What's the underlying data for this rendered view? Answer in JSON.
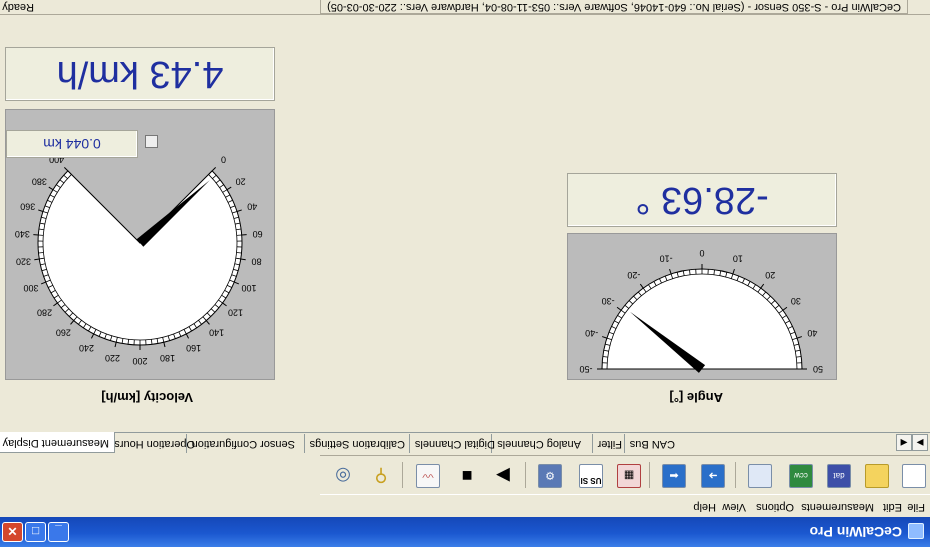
{
  "window": {
    "title": "CeCalWin Pro"
  },
  "menu": [
    "File",
    "Edit",
    "Measurements",
    "Options",
    "View",
    "Help"
  ],
  "toolbar": [
    {
      "icon": "new-file-icon"
    },
    {
      "icon": "open-folder-icon"
    },
    {
      "icon": "save-disk-icon",
      "label": "dat"
    },
    {
      "icon": "export-ccw-icon",
      "label": "ccw"
    },
    {
      "icon": "panel-view-icon"
    },
    {
      "icon": "import-right-icon"
    },
    {
      "icon": "import-left-icon"
    },
    {
      "icon": "chart-grid-icon"
    },
    {
      "icon": "units-toggle-icon",
      "label": "US SI"
    },
    {
      "icon": "sensor-settings-icon"
    },
    {
      "icon": "play-icon"
    },
    {
      "icon": "stop-icon"
    },
    {
      "icon": "scope-icon"
    },
    {
      "icon": "probe-icon"
    },
    {
      "icon": "about-icon"
    }
  ],
  "tabs": [
    "Measurement Display",
    "Operation Hours",
    "Sensor Configuration",
    "Calibration Settings",
    "Digital Channels",
    "Analog Channels",
    "Filter",
    "CAN Bus"
  ],
  "velocity": {
    "display": "4.43 km/h",
    "distance": "0.044 km",
    "label": "Velocity [km/h]",
    "ticks": [
      "0",
      "20",
      "40",
      "60",
      "80",
      "100",
      "120",
      "140",
      "160",
      "180",
      "200",
      "220",
      "240",
      "260",
      "280",
      "300",
      "320",
      "340",
      "360",
      "380",
      "400"
    ],
    "value": 4.43
  },
  "angle": {
    "display": "-28.63 °",
    "label": "Angle [°]",
    "ticks": [
      "-50",
      "-40",
      "-30",
      "-20",
      "-10",
      "0",
      "10",
      "20",
      "30",
      "40",
      "50"
    ],
    "value": -28.63
  },
  "status": {
    "left": "Ready",
    "right": "CeCalWin Pro - S-350 Sensor - (Serial No.: 640-14046, Software Vers.: 053-11-08-04, Hardware Vers.: 220-30-03-05)"
  }
}
